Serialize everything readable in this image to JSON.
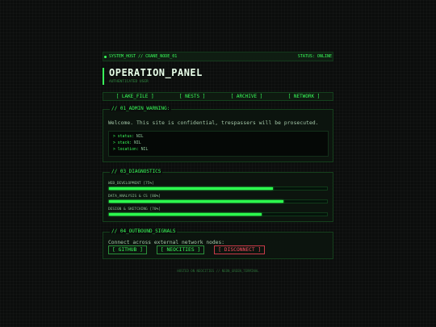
{
  "topbar": {
    "host": "SYSTEM_HOST // CRANE_NODE_01",
    "status": "STATUS: ONLINE"
  },
  "header": {
    "title": "OPERATION_PANEL",
    "subtitle": "AUTHENTICATED USER"
  },
  "nav": [
    "[ LAKE_FILE ]",
    "[ NESTS ]",
    "[ ARCHIVE ]",
    "[ NETWORK ]"
  ],
  "admin": {
    "legend": "// 01_ADMIN_WARNING:",
    "message": "Welcome. This site is confidential, trespassers will be prosecuted.",
    "lines": [
      {
        "key": "> status:",
        "val": "NIL"
      },
      {
        "key": "> stack:",
        "val": "NIL"
      },
      {
        "key": "> location:",
        "val": "NIL"
      }
    ]
  },
  "diagnostics": {
    "legend": "// 03_DIAGNOSTICS",
    "skills": [
      {
        "label": "WEB_DEVELOPMENT [75%]",
        "value": 75
      },
      {
        "label": "DATA_ANALYSIS & CS [80%]",
        "value": 80
      },
      {
        "label": "DESIGN & SKETCHING [70%]",
        "value": 70
      }
    ]
  },
  "signals": {
    "legend": "// 04_OUTBOUND_SIGNALS",
    "message": "Connect across external network nodes:",
    "buttons": [
      "[ GITHUB ]",
      "[ NEOCITIES ]",
      "[ DISCONNECT ]"
    ]
  },
  "footer": "HOSTED ON NEOCITIES // NEON_GREEN_TERMINAL",
  "colors": {
    "accent": "#39ff5a",
    "danger": "#ff4d60",
    "background": "#0b0d0c"
  }
}
